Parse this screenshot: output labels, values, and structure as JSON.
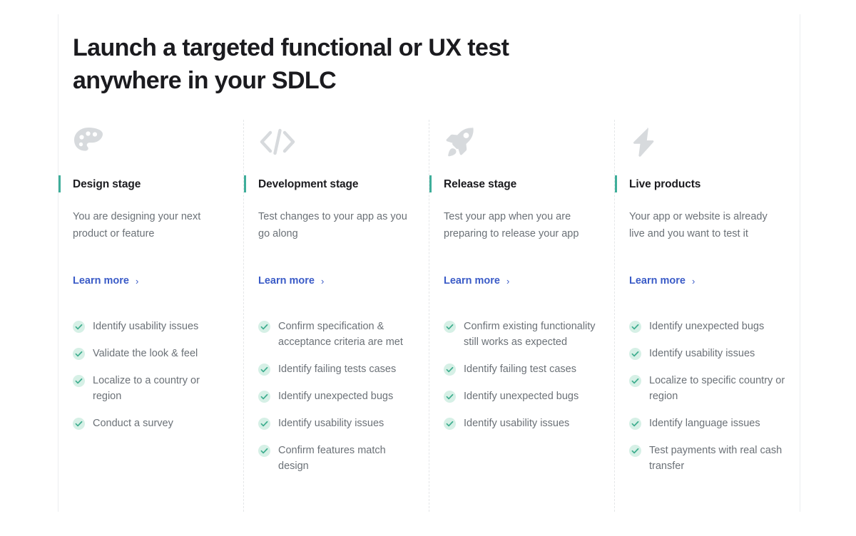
{
  "headline": "Launch a targeted functional or UX test anywhere in your SDLC",
  "accent_color": "#3fae9a",
  "link_color": "#3a5bc7",
  "check_badge_color": "#d6f0e6",
  "check_mark_color": "#3fae8f",
  "icon_color": "#d7dadd",
  "columns": [
    {
      "icon": "palette-icon",
      "title": "Design stage",
      "description": "You are designing your next product or feature",
      "link_label": "Learn more",
      "link_chevron": "›",
      "items": [
        "Identify usability issues",
        "Validate the look & feel",
        "Localize to a country or region",
        "Conduct a survey"
      ]
    },
    {
      "icon": "code-brackets-icon",
      "title": "Development stage",
      "description": "Test changes to your app as you go along",
      "link_label": "Learn more",
      "link_chevron": "›",
      "items": [
        "Confirm specification & acceptance criteria are met",
        "Identify failing tests cases",
        "Identify unexpected bugs",
        "Identify usability issues",
        "Confirm features match design"
      ]
    },
    {
      "icon": "rocket-icon",
      "title": "Release stage",
      "description": "Test your app when you are preparing to release your app",
      "link_label": "Learn more",
      "link_chevron": "›",
      "items": [
        "Confirm existing functionality still works as expected",
        "Identify failing test cases",
        "Identify unexpected bugs",
        "Identify usability issues"
      ]
    },
    {
      "icon": "lightning-bolt-icon",
      "title": "Live products",
      "description": "Your app or website is already live and you want to test it",
      "link_label": "Learn more",
      "link_chevron": "›",
      "items": [
        "Identify unexpected bugs",
        "Identify usability issues",
        "Localize to specific country or region",
        "Identify language issues",
        "Test payments with real cash transfer"
      ]
    }
  ]
}
